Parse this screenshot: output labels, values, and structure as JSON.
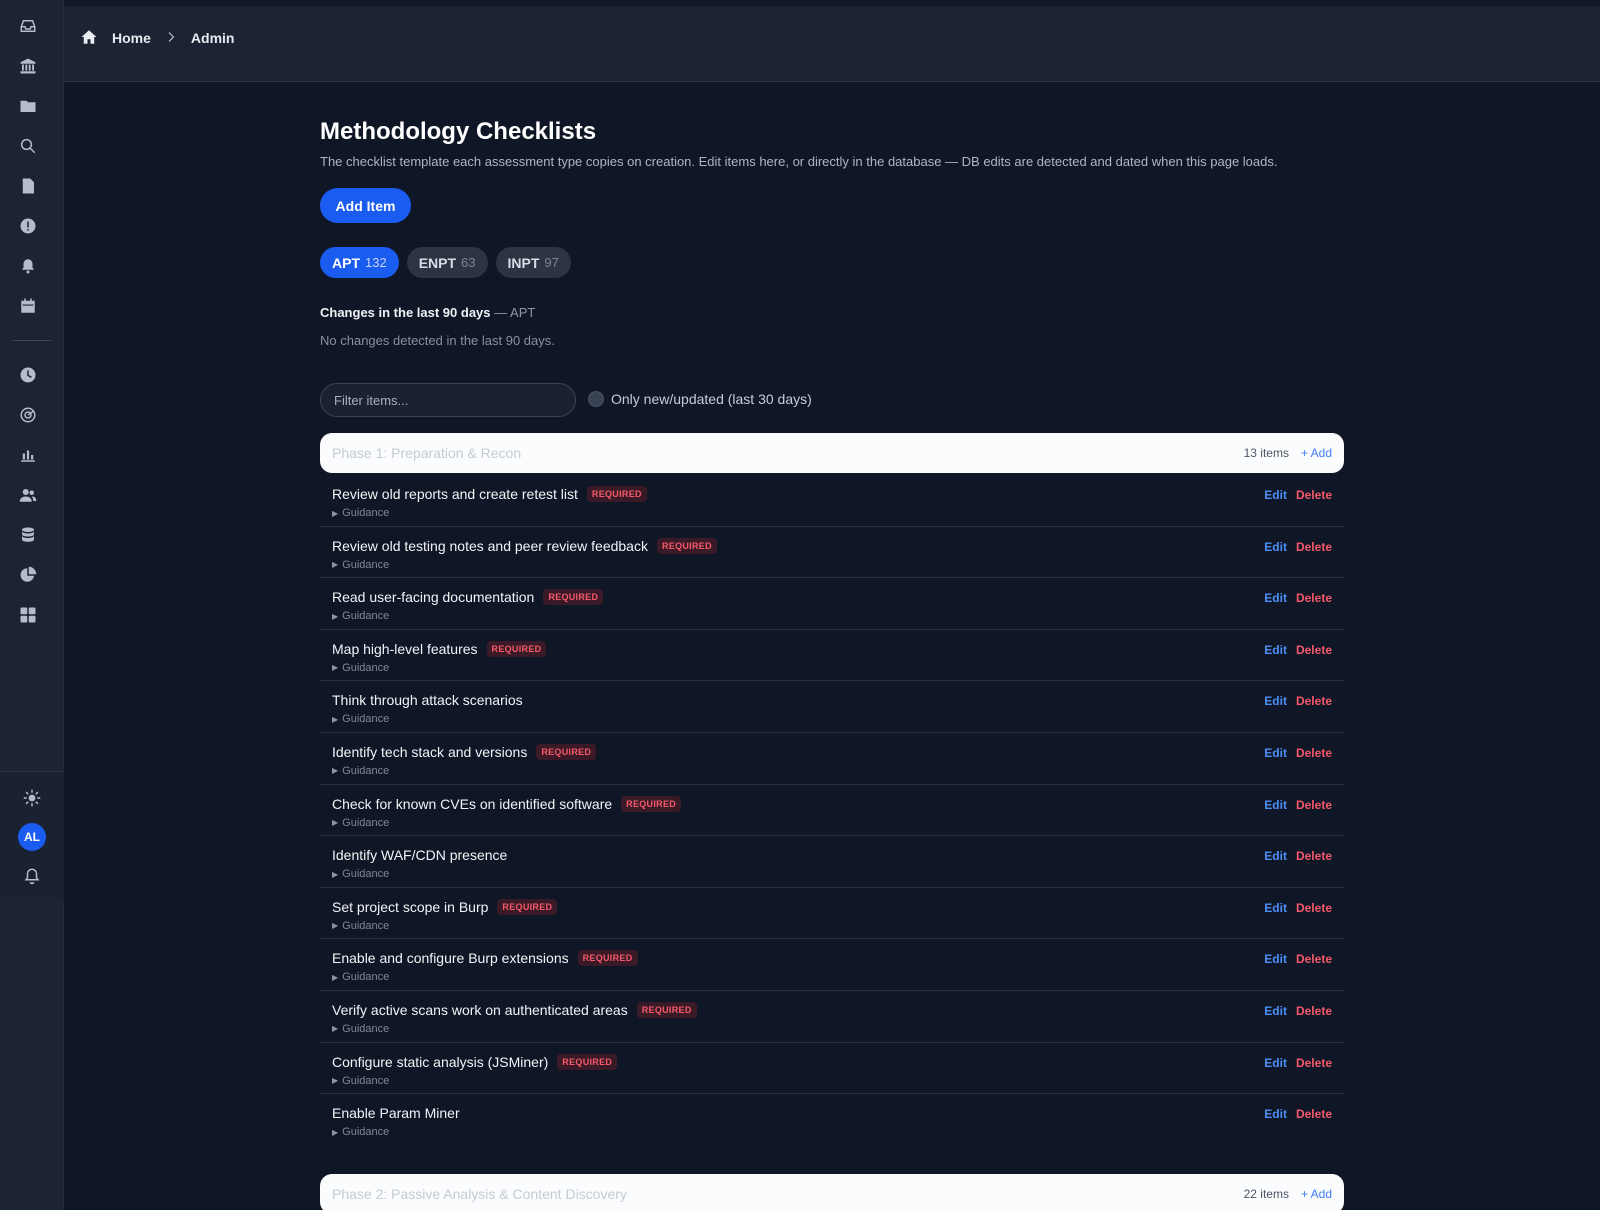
{
  "sidebar": {
    "nav_icons": [
      "inbox-icon",
      "bank-icon",
      "folder-icon",
      "search-icon",
      "report-icon",
      "alert-icon",
      "bell-icon",
      "calendar-icon",
      "clock-icon",
      "radar-icon",
      "chart-icon",
      "users-icon",
      "database-icon",
      "pie-chart-icon",
      "grid-icon"
    ],
    "bottom_icons": [
      "sun-icon",
      "notifications-icon"
    ],
    "avatar_initials": "AL"
  },
  "header": {
    "breadcrumb": [
      "Home",
      "Admin"
    ]
  },
  "page": {
    "title": "Methodology Checklists",
    "description": "The checklist template each assessment type copies on creation. Edit items here, or directly in the database — DB edits are detected and dated when this page loads.",
    "add_item_label": "Add Item"
  },
  "tabs": [
    {
      "label": "APT",
      "count": "132",
      "active": true
    },
    {
      "label": "ENPT",
      "count": "63",
      "active": false
    },
    {
      "label": "INPT",
      "count": "97",
      "active": false
    }
  ],
  "changes": {
    "heading": "Changes in the last 90 days",
    "suffix": "— APT",
    "empty_text": "No changes detected in the last 90 days."
  },
  "filter": {
    "placeholder": "Filter items...",
    "toggle_label": "Only new/updated (last 30 days)"
  },
  "actions": {
    "edit": "Edit",
    "delete": "Delete",
    "guidance": "Guidance",
    "required_badge": "REQUIRED"
  },
  "phases": [
    {
      "title": "Phase 1: Preparation & Recon",
      "count": "13 items",
      "add_label": "+ Add",
      "items": [
        {
          "title": "Review old reports and create retest list",
          "required": true
        },
        {
          "title": "Review old testing notes and peer review feedback",
          "required": true
        },
        {
          "title": "Read user-facing documentation",
          "required": true
        },
        {
          "title": "Map high-level features",
          "required": true
        },
        {
          "title": "Think through attack scenarios",
          "required": false
        },
        {
          "title": "Identify tech stack and versions",
          "required": true
        },
        {
          "title": "Check for known CVEs on identified software",
          "required": true
        },
        {
          "title": "Identify WAF/CDN presence",
          "required": false
        },
        {
          "title": "Set project scope in Burp",
          "required": true
        },
        {
          "title": "Enable and configure Burp extensions",
          "required": true
        },
        {
          "title": "Verify active scans work on authenticated areas",
          "required": true
        },
        {
          "title": "Configure static analysis (JSMiner)",
          "required": true
        },
        {
          "title": "Enable Param Miner",
          "required": false
        }
      ]
    },
    {
      "title": "Phase 2: Passive Analysis & Content Discovery",
      "count": "22 items",
      "add_label": "+ Add",
      "items": []
    }
  ],
  "colors": {
    "accent": "#1a5cf0",
    "danger": "#f4596b",
    "link": "#4d8ff7",
    "background": "#0f1626",
    "sidebar": "#1c2433"
  }
}
